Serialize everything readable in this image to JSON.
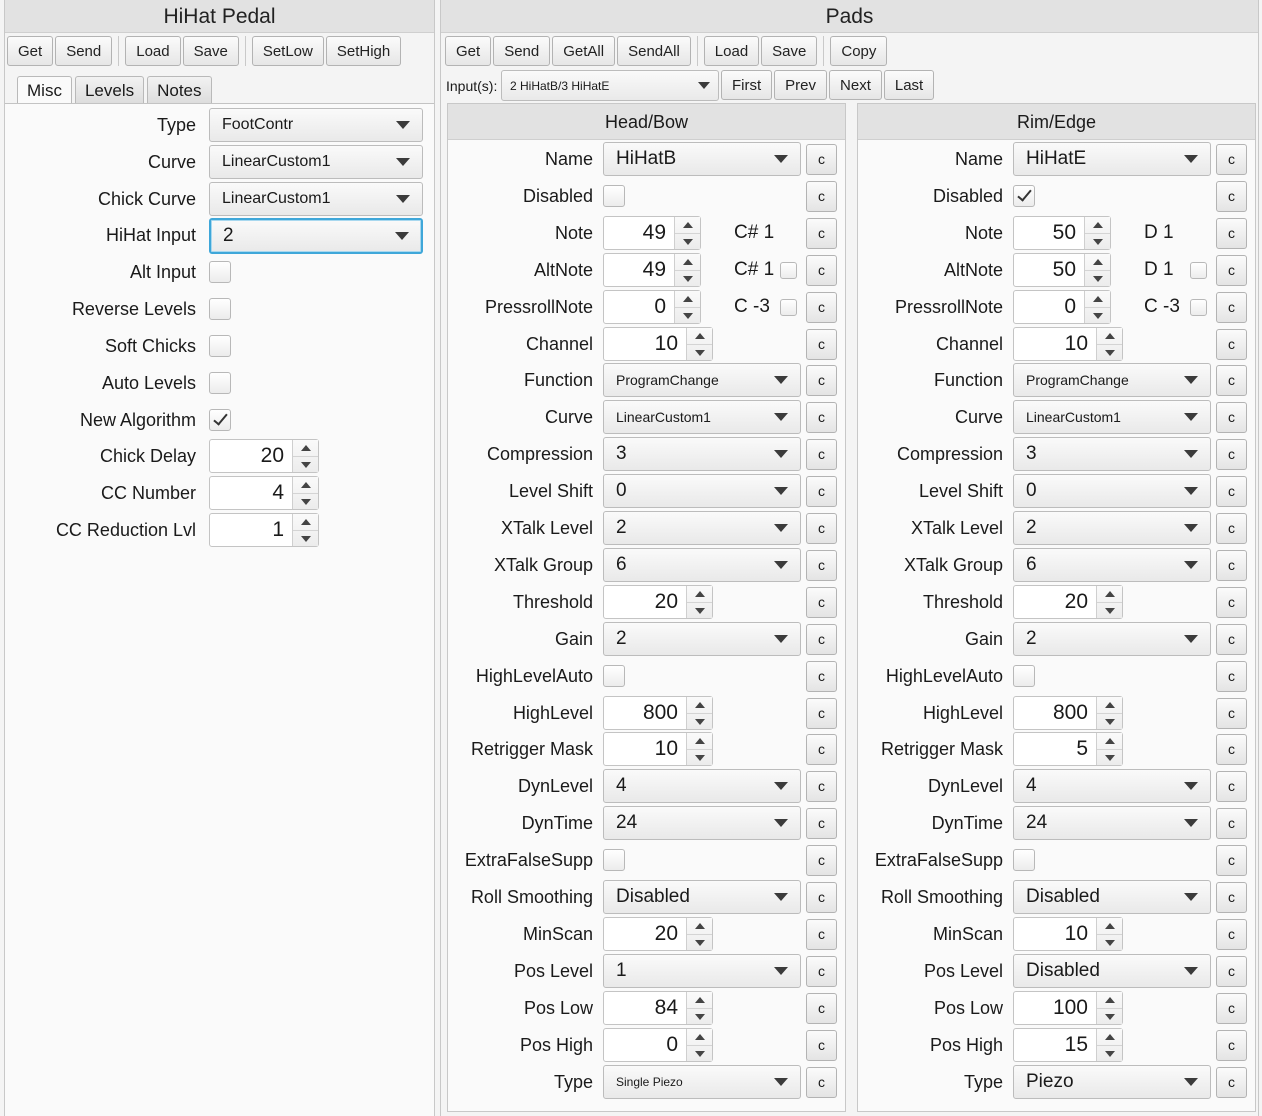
{
  "hihat": {
    "title": "HiHat Pedal",
    "toolbar": [
      "Get",
      "Send",
      "Load",
      "Save",
      "SetLow",
      "SetHigh"
    ],
    "tabs": [
      "Misc",
      "Levels",
      "Notes"
    ],
    "fields": {
      "type": {
        "label": "Type",
        "value": "FootContr"
      },
      "curve": {
        "label": "Curve",
        "value": "LinearCustom1"
      },
      "chick_curve": {
        "label": "Chick Curve",
        "value": "LinearCustom1"
      },
      "hihat_input": {
        "label": "HiHat Input",
        "value": "2"
      },
      "alt_input": {
        "label": "Alt Input",
        "checked": false
      },
      "reverse_levels": {
        "label": "Reverse Levels",
        "checked": false
      },
      "soft_chicks": {
        "label": "Soft Chicks",
        "checked": false
      },
      "auto_levels": {
        "label": "Auto Levels",
        "checked": false
      },
      "new_algorithm": {
        "label": "New Algorithm",
        "checked": true
      },
      "chick_delay": {
        "label": "Chick Delay",
        "value": "20"
      },
      "cc_number": {
        "label": "CC Number",
        "value": "4"
      },
      "cc_reduction": {
        "label": "CC Reduction Lvl",
        "value": "1"
      }
    }
  },
  "pads": {
    "title": "Pads",
    "toolbar": [
      "Get",
      "Send",
      "GetAll",
      "SendAll",
      "Load",
      "Save",
      "Copy"
    ],
    "input_label": "Input(s):",
    "input_value": "2 HiHatB/3 HiHatE",
    "nav": [
      "First",
      "Prev",
      "Next",
      "Last"
    ],
    "copy_label": "c",
    "labels": {
      "name": "Name",
      "disabled": "Disabled",
      "note": "Note",
      "altnote": "AltNote",
      "pressroll": "PressrollNote",
      "channel": "Channel",
      "function": "Function",
      "curve": "Curve",
      "compression": "Compression",
      "levelshift": "Level Shift",
      "xtalklevel": "XTalk Level",
      "xtalkgroup": "XTalk Group",
      "threshold": "Threshold",
      "gain": "Gain",
      "highlevelauto": "HighLevelAuto",
      "highlevel": "HighLevel",
      "retrigger": "Retrigger Mask",
      "dynlevel": "DynLevel",
      "dyntime": "DynTime",
      "extrafalse": "ExtraFalseSupp",
      "rollsmoothing": "Roll Smoothing",
      "minscan": "MinScan",
      "poslevel": "Pos Level",
      "poslow": "Pos Low",
      "poshigh": "Pos High",
      "type": "Type"
    },
    "head": {
      "title": "Head/Bow",
      "name": "HiHatB",
      "disabled": false,
      "note": "49",
      "note_name": "C# 1",
      "altnote": "49",
      "altnote_name": "C# 1",
      "altnote_chk": false,
      "pressroll": "0",
      "pressroll_name": "C  -3",
      "pressroll_chk": false,
      "channel": "10",
      "function": "ProgramChange",
      "curve": "LinearCustom1",
      "compression": "3",
      "levelshift": "0",
      "xtalklevel": "2",
      "xtalkgroup": "6",
      "threshold": "20",
      "gain": "2",
      "highlevelauto": false,
      "highlevel": "800",
      "retrigger": "10",
      "dynlevel": "4",
      "dyntime": "24",
      "extrafalse": false,
      "rollsmoothing": "Disabled",
      "minscan": "20",
      "poslevel": "1",
      "poslow": "84",
      "poshigh": "0",
      "type": "Single Piezo"
    },
    "rim": {
      "title": "Rim/Edge",
      "name": "HiHatE",
      "disabled": true,
      "note": "50",
      "note_name": "D  1",
      "altnote": "50",
      "altnote_name": "D  1",
      "altnote_chk": false,
      "pressroll": "0",
      "pressroll_name": "C  -3",
      "pressroll_chk": false,
      "channel": "10",
      "function": "ProgramChange",
      "curve": "LinearCustom1",
      "compression": "3",
      "levelshift": "0",
      "xtalklevel": "2",
      "xtalkgroup": "6",
      "threshold": "20",
      "gain": "2",
      "highlevelauto": false,
      "highlevel": "800",
      "retrigger": "5",
      "dynlevel": "4",
      "dyntime": "24",
      "extrafalse": false,
      "rollsmoothing": "Disabled",
      "minscan": "10",
      "poslevel": "Disabled",
      "poslow": "100",
      "poshigh": "15",
      "type": "Piezo"
    }
  }
}
